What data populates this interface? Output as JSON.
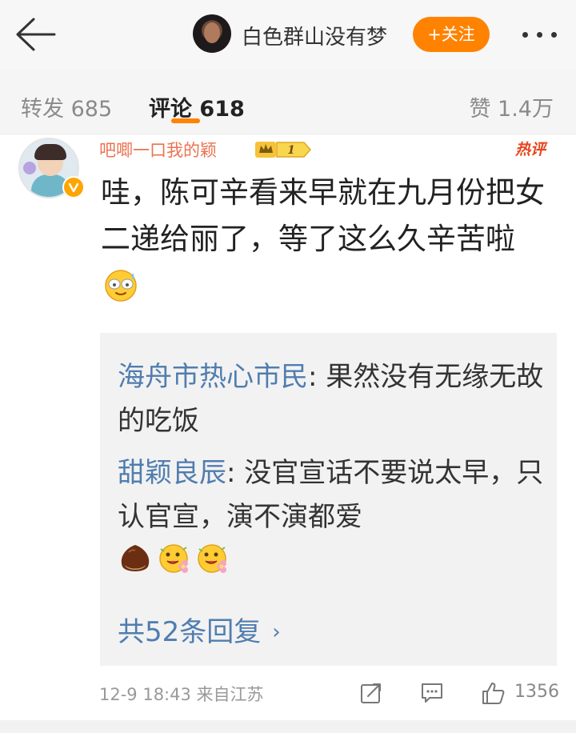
{
  "header": {
    "username": "白色群山没有梦",
    "follow_label": "+关注"
  },
  "tabs": {
    "repost_label": "转发",
    "repost_count": "685",
    "comment_label": "评论",
    "comment_count": "618",
    "like_label": "赞",
    "like_count": "1.4万"
  },
  "comment": {
    "username": "吧唧一口我的颖",
    "level": "1",
    "hot_tag": "热评",
    "text": "哇，陈可辛看来早就在九月份把女二递给丽了，等了这么久辛苦啦",
    "emoji": "sweat-smile-emoji",
    "replies": [
      {
        "name": "海舟市热心市民",
        "text": ": 果然没有无缘无故的吃饭"
      },
      {
        "name": "甜颖良辰",
        "text": ": 没官宣话不要说太早，只认官宣，演不演都爱"
      }
    ],
    "more_replies_label": "共52条回复",
    "timestamp": "12-9 18:43",
    "source": "来自江苏",
    "like_count": "1356"
  },
  "colors": {
    "accent": "#ff8200",
    "username": "#eb7350",
    "link": "#507daf",
    "hot": "#e8451e"
  }
}
